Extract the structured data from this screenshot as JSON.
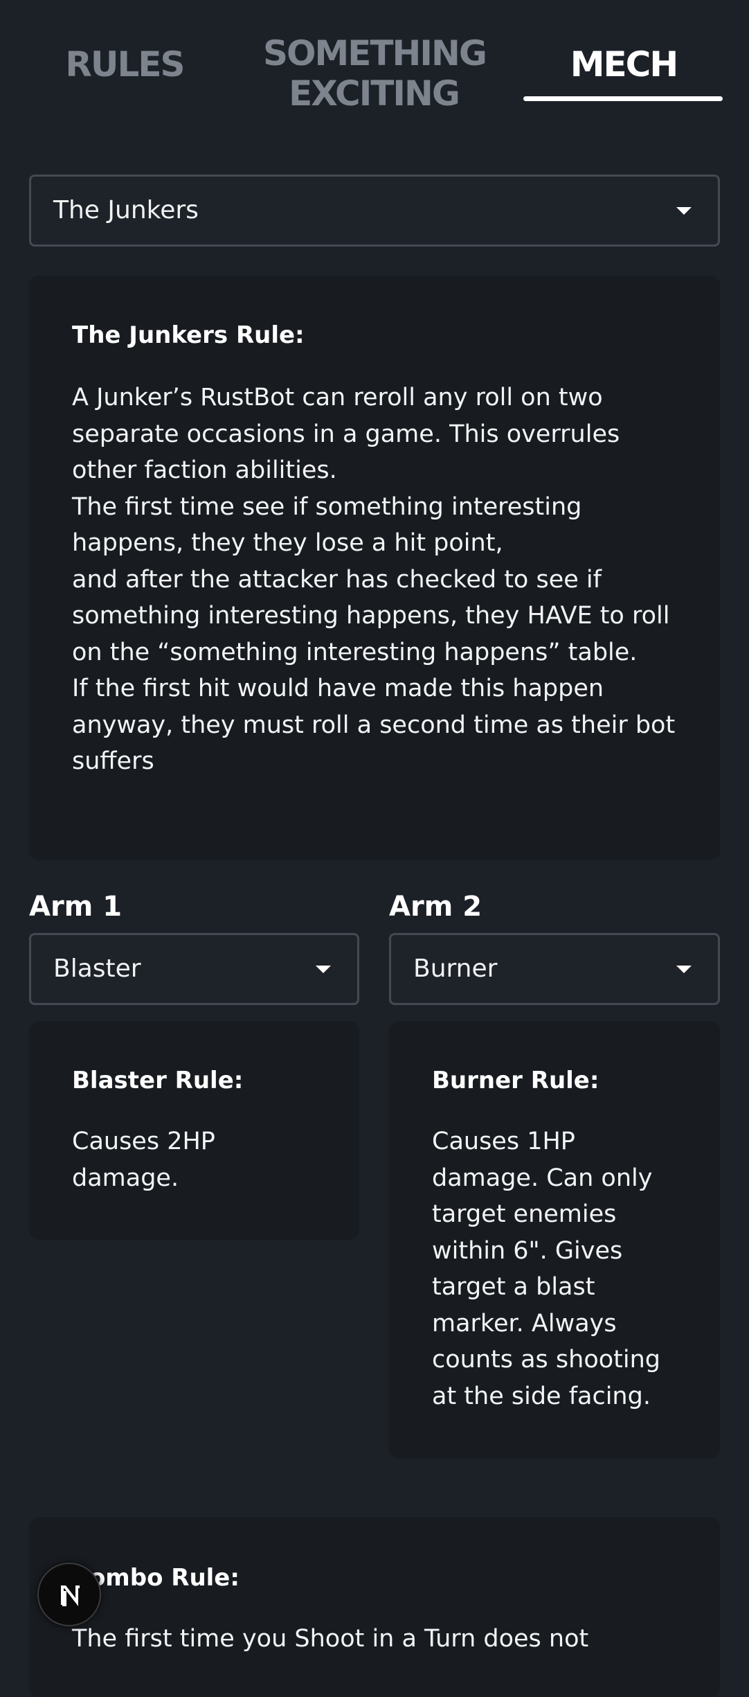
{
  "tabs": {
    "rules": "RULES",
    "exciting_line1": "SOMETHING",
    "exciting_line2": "EXCITING",
    "mech": "MECH",
    "active": "MECH"
  },
  "faction_select": {
    "value": "The Junkers",
    "icon": "caret-down-icon"
  },
  "faction_card": {
    "title": "The Junkers Rule:",
    "body": "A Junker’s RustBot can reroll any roll on two separate occasions in a game. This overrules other faction abilities.\nThe first time see if something interesting happens, they they lose a hit point,\nand after the attacker has checked to see if something interesting happens, they HAVE to roll on the “something interesting happens” table.\nIf the first hit would have made this happen anyway, they must roll a second time as their bot suffers"
  },
  "arm1": {
    "label": "Arm 1",
    "value": "Blaster",
    "rule_title": "Blaster Rule:",
    "rule_body": "Causes 2HP damage."
  },
  "arm2": {
    "label": "Arm 2",
    "value": "Burner",
    "rule_title": "Burner Rule:",
    "rule_body": "Causes 1HP damage. Can only target enemies within 6\". Gives target a blast marker. Always counts as shooting at the side facing."
  },
  "combo_card": {
    "title": "Combo Rule:",
    "body": "The first time you Shoot in a Turn does not"
  },
  "fab": {
    "icon": "nextjs-n-logo-icon"
  },
  "colors": {
    "background": "#1c2128",
    "card": "#181c21",
    "inactive_tab": "#7d848d",
    "active_tab": "#ffffff"
  }
}
